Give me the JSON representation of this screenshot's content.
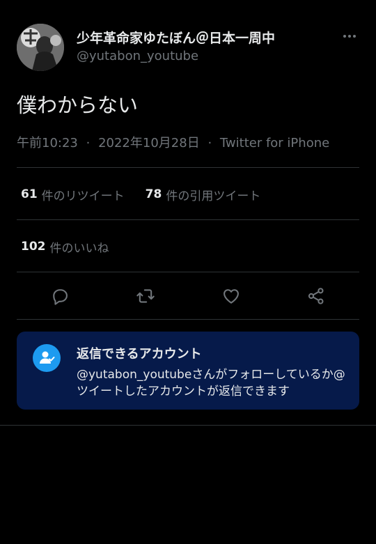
{
  "tweet": {
    "author": {
      "display_name": "少年革命家ゆたぼん＠日本一周中",
      "handle": "@yutabon_youtube"
    },
    "text": "僕わからない",
    "meta": {
      "time": "午前10:23",
      "date": "2022年10月28日",
      "source": "Twitter for iPhone",
      "separator": "·"
    },
    "stats": {
      "retweets": {
        "count": "61",
        "label": "件のリツイート"
      },
      "quote_tweets": {
        "count": "78",
        "label": "件の引用ツイート"
      },
      "likes": {
        "count": "102",
        "label": "件のいいね"
      }
    },
    "actions": [
      {
        "name": "reply",
        "icon": "reply-icon"
      },
      {
        "name": "retweet",
        "icon": "retweet-icon"
      },
      {
        "name": "like",
        "icon": "heart-icon"
      },
      {
        "name": "share",
        "icon": "share-icon"
      }
    ]
  },
  "reply_notice": {
    "title": "返信できるアカウント",
    "body": "@yutabon_youtubeさんがフォローしているか@ツイートしたアカウントが返信できます",
    "icon": "user-check-icon"
  },
  "colors": {
    "background": "#000000",
    "primary_text": "#e7e9ea",
    "secondary_text": "#71767b",
    "divider": "#2f3336",
    "notice_background": "#061a4a",
    "accent": "#1d9bf0"
  }
}
